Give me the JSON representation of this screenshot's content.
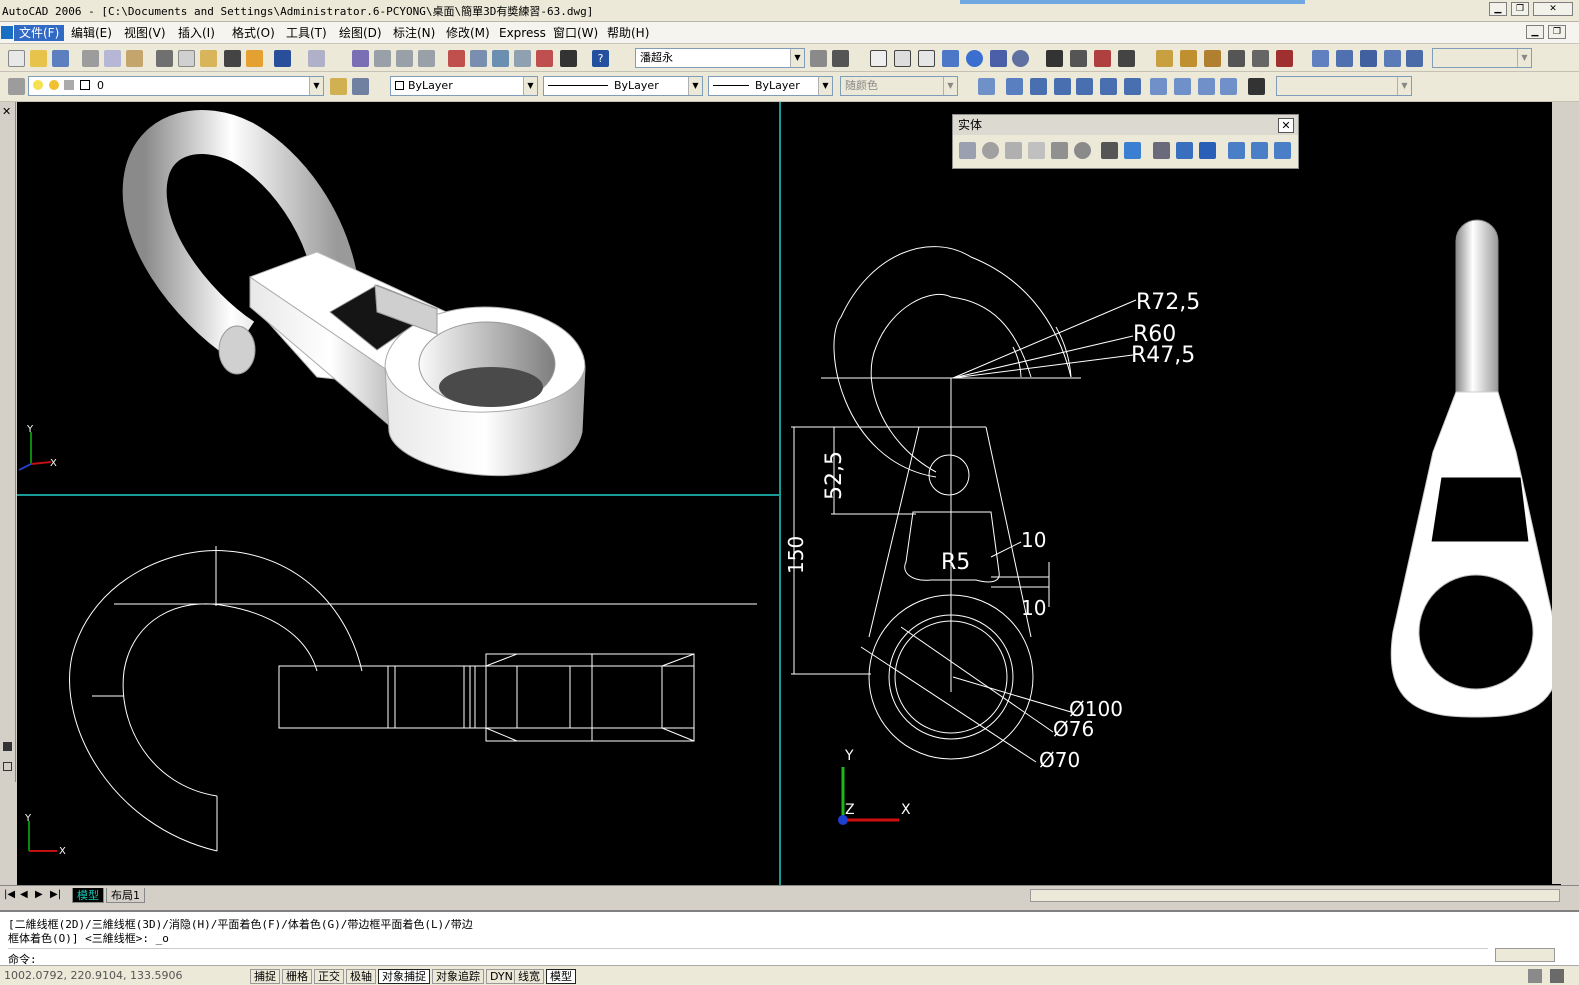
{
  "app": {
    "title": "AutoCAD 2006 - [C:\\Documents and Settings\\Administrator.6-PCYONG\\桌面\\簡單3D有奬練習-63.dwg]"
  },
  "menu": [
    "文件(F)",
    "编辑(E)",
    "视图(V)",
    "插入(I)",
    "格式(O)",
    "工具(T)",
    "绘图(D)",
    "标注(N)",
    "修改(M)",
    "Express",
    "窗口(W)",
    "帮助(H)"
  ],
  "toolbar": {
    "textstyle": "潘超永",
    "layer": "0",
    "color": "ByLayer",
    "linetype": "ByLayer",
    "lineweight": "ByLayer",
    "plotstyle": "随颜色"
  },
  "solid_toolbar": {
    "title": "实体",
    "close": "✕"
  },
  "drawing": {
    "dims": {
      "r72": "R72,5",
      "r60": "R60",
      "r47": "R47,5",
      "d52": "52,5",
      "d150": "150",
      "t10a": "10",
      "t10b": "10",
      "r5": "R5",
      "d100": "Ø100",
      "d76": "Ø76",
      "d70": "Ø70"
    },
    "ucs": {
      "x": "X",
      "y": "Y",
      "z": "Z"
    }
  },
  "tabs": [
    "模型",
    "布局1"
  ],
  "command": {
    "line1": "[二維线框(2D)/三維线框(3D)/消隐(H)/平面着色(F)/体着色(G)/带边框平面着色(L)/带边",
    "line2": "框体着色(O)] <三維线框>: _o",
    "prompt": "命令:"
  },
  "status": {
    "coords": "1002.0792, 220.9104, 133.5906",
    "buttons": [
      "捕捉",
      "栅格",
      "正交",
      "极轴",
      "对象捕捉",
      "对象追踪",
      "DYN",
      "线宽",
      "模型"
    ]
  }
}
